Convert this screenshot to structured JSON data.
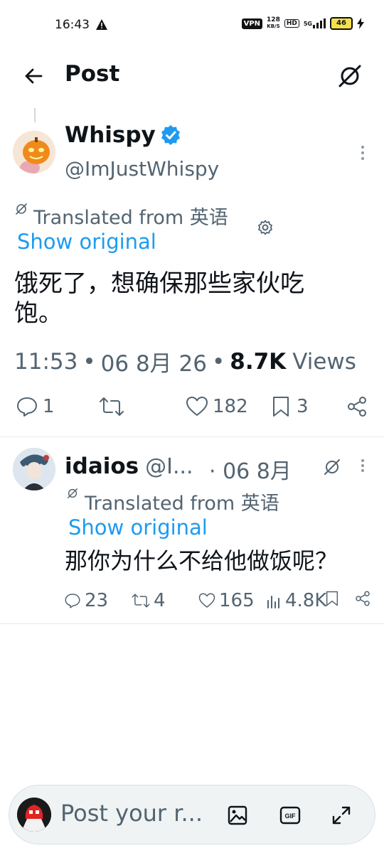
{
  "status_bar": {
    "time": "16:43",
    "vpn_badge": "VPN",
    "net_speed_value": "128",
    "net_speed_unit": "KB/S",
    "hd_badge": "HD",
    "network": "5G",
    "battery_level": "46"
  },
  "header": {
    "title": "Post"
  },
  "post": {
    "display_name": "Whispy",
    "handle": "@ImJustWhispy",
    "translated_label": "Translated from 英语",
    "show_original": "Show original",
    "text_line1": "饿死了，想确保那些家伙吃",
    "text_line2": "饱。",
    "time": "11:53",
    "date": "06 8月 26",
    "views_count": "8.7K",
    "views_label": "Views",
    "reply_count": "1",
    "like_count": "182",
    "bookmark_count": "3"
  },
  "reply": {
    "display_name": "idaios",
    "handle_truncated": "@I...",
    "date": "· 06 8月",
    "translated_label": "Translated from 英语",
    "show_original": "Show original",
    "text": "那你为什么不给他做饭呢？",
    "reply_count": "23",
    "repost_count": "4",
    "like_count": "165",
    "views_count": "4.8K"
  },
  "composer": {
    "placeholder": "Post your r..."
  },
  "colors": {
    "accent": "#1d9bf0",
    "muted": "#536471",
    "text": "#0f1419"
  }
}
